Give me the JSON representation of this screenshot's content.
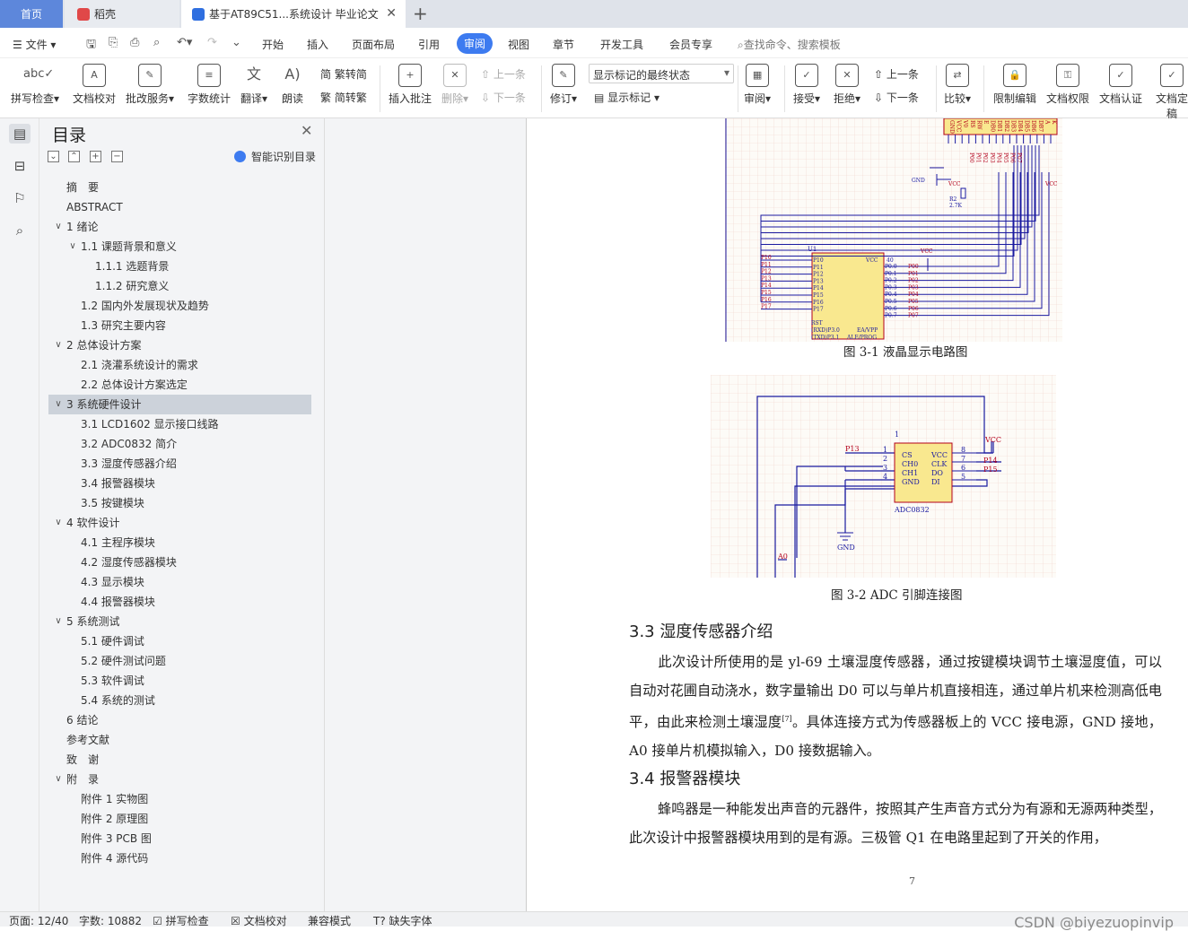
{
  "tabs": {
    "home": "首页",
    "daoke": "稻壳",
    "doc": "基于AT89C51...系统设计 毕业论文"
  },
  "menu": {
    "file": "文件",
    "items": [
      "开始",
      "插入",
      "页面布局",
      "引用",
      "审阅",
      "视图",
      "章节",
      "开发工具",
      "会员专享"
    ],
    "search": "查找命令、搜索模板"
  },
  "ribbon": {
    "spell": "拼写检查",
    "proof": "文档校对",
    "batch": "批改服务",
    "wordcount": "字数统计",
    "translate": "翻译",
    "read": "朗读",
    "trad2simp": "繁转简",
    "simp2trad": "简转繁",
    "addcomment": "插入批注",
    "delete": "删除",
    "prev": "上一条",
    "next": "下一条",
    "revise": "修订",
    "markup_state": "显示标记的最终状态",
    "show_markup": "显示标记",
    "review": "审阅",
    "accept": "接受",
    "reject": "拒绝",
    "prev2": "上一条",
    "next2": "下一条",
    "compare": "比较",
    "restrict": "限制编辑",
    "permission": "文档权限",
    "certify": "文档认证",
    "final": "文档定稿"
  },
  "toc": {
    "title": "目录",
    "smart": "智能识别目录",
    "items": [
      {
        "text": "摘　要",
        "level": 0,
        "arrow": ""
      },
      {
        "text": "ABSTRACT",
        "level": 0,
        "arrow": ""
      },
      {
        "text": "1  绪论",
        "level": 0,
        "arrow": "v"
      },
      {
        "text": "1.1  课题背景和意义",
        "level": 1,
        "arrow": "v"
      },
      {
        "text": "1.1.1 选题背景",
        "level": 2,
        "arrow": ""
      },
      {
        "text": "1.1.2 研究意义",
        "level": 2,
        "arrow": ""
      },
      {
        "text": "1.2  国内外发展现状及趋势",
        "level": 1,
        "arrow": ""
      },
      {
        "text": "1.3 研究主要内容",
        "level": 1,
        "arrow": ""
      },
      {
        "text": "2  总体设计方案",
        "level": 0,
        "arrow": "v"
      },
      {
        "text": "2.1  浇灌系统设计的需求",
        "level": 1,
        "arrow": ""
      },
      {
        "text": "2.2  总体设计方案选定",
        "level": 1,
        "arrow": ""
      },
      {
        "text": "3  系统硬件设计",
        "level": 0,
        "arrow": "v",
        "selected": true
      },
      {
        "text": "3.1 LCD1602 显示接口线路",
        "level": 1,
        "arrow": ""
      },
      {
        "text": "3.2 ADC0832 简介",
        "level": 1,
        "arrow": ""
      },
      {
        "text": "3.3  湿度传感器介绍",
        "level": 1,
        "arrow": ""
      },
      {
        "text": "3.4  报警器模块",
        "level": 1,
        "arrow": ""
      },
      {
        "text": "3.5  按键模块",
        "level": 1,
        "arrow": ""
      },
      {
        "text": "4  软件设计",
        "level": 0,
        "arrow": "v"
      },
      {
        "text": "4.1  主程序模块",
        "level": 1,
        "arrow": ""
      },
      {
        "text": "4.2  湿度传感器模块",
        "level": 1,
        "arrow": ""
      },
      {
        "text": "4.3  显示模块",
        "level": 1,
        "arrow": ""
      },
      {
        "text": "4.4  报警器模块",
        "level": 1,
        "arrow": ""
      },
      {
        "text": "5  系统测试",
        "level": 0,
        "arrow": "v"
      },
      {
        "text": "5.1  硬件调试",
        "level": 1,
        "arrow": ""
      },
      {
        "text": "5.2  硬件测试问题",
        "level": 1,
        "arrow": ""
      },
      {
        "text": "5.3  软件调试",
        "level": 1,
        "arrow": ""
      },
      {
        "text": "5.4  系统的测试",
        "level": 1,
        "arrow": ""
      },
      {
        "text": "6  结论",
        "level": 0,
        "arrow": ""
      },
      {
        "text": "参考文献",
        "level": 0,
        "arrow": ""
      },
      {
        "text": "致　谢",
        "level": 0,
        "arrow": ""
      },
      {
        "text": "附　录",
        "level": 0,
        "arrow": "v"
      },
      {
        "text": "附件 1  实物图",
        "level": 1,
        "arrow": ""
      },
      {
        "text": "附件 2  原理图",
        "level": 1,
        "arrow": ""
      },
      {
        "text": "附件 3  PCB 图",
        "level": 1,
        "arrow": ""
      },
      {
        "text": "附件 4  源代码",
        "level": 1,
        "arrow": ""
      }
    ]
  },
  "doc": {
    "cap1": "图 3-1  液晶显示电路图",
    "cap2": "图 3-2 ADC 引脚连接图",
    "h33": "3.3  湿度传感器介绍",
    "p33a": "此次设计所使用的是 yl-69 土壤湿度传感器，通过按键模块调节土壤湿度值，可以自动对花圃自动浇水，数字量输出 D0 可以与单片机直接相连，通过单片机来检测高低电平，由此来检测土壤湿度",
    "ref": "[7]",
    "p33b": "。具体连接方式为传感器板上的 VCC 接电源，GND 接地，A0 接单片机模拟输入，D0 接数据输入。",
    "h34": "3.4  报警器模块",
    "p34": "蜂鸣器是一种能发出声音的元器件，按照其产生声音方式分为有源和无源两种类型，此次设计中报警器模块用到的是有源。三极管 Q1 在电路里起到了开关的作用，",
    "pagenum": "7"
  },
  "schematic1": {
    "chip": "U1",
    "vcc": "VCC",
    "gnd": "GND",
    "r2": "R2",
    "r2val": "2.7K",
    "port1": [
      "P10",
      "P11",
      "P12",
      "P13",
      "P14",
      "P15",
      "P16",
      "P17"
    ],
    "port0": [
      "P0.0",
      "P0.1",
      "P0.2",
      "P0.3",
      "P0.4",
      "P0.5",
      "P0.6",
      "P0.7"
    ],
    "p0nets": [
      "P00",
      "P01",
      "P02",
      "P03",
      "P04",
      "P05",
      "P06",
      "P07"
    ],
    "lcdpins": [
      "GND",
      "VCC",
      "V0",
      "RS",
      "RW",
      "E",
      "DB0",
      "DB1",
      "DB2",
      "DB3",
      "DB4",
      "DB5",
      "DB6",
      "DB7",
      "A",
      "K"
    ],
    "rst": "RST",
    "rxd": "(RXD)P3.0",
    "txd": "(TXD)P3.1",
    "ea": "EA/VPP",
    "ale": "ALE/PROG",
    "pin40": "40"
  },
  "schematic2": {
    "chip": "ADC0832",
    "pin1label": "1",
    "left_pins": [
      "CS",
      "CH0",
      "CH1",
      "GND"
    ],
    "right_pins": [
      "VCC",
      "CLK",
      "DO",
      "DI"
    ],
    "left_nums": [
      "1",
      "2",
      "3",
      "4"
    ],
    "right_nums": [
      "8",
      "7",
      "6",
      "5"
    ],
    "nets": {
      "p13": "P13",
      "p14": "P14",
      "p15": "P15",
      "vcc": "VCC",
      "gnd": "GND",
      "a0": "A0"
    }
  },
  "status": {
    "page": "页面: 12/40",
    "words": "字数: 10882",
    "spell": "拼写检查",
    "proof": "文档校对",
    "compat": "兼容模式",
    "font": "缺失字体"
  },
  "watermark": "CSDN @biyezuopinvip",
  "colors": {
    "accent": "#3d7bf0",
    "home_tab": "#5d87db",
    "schematic_wire": "#1a1aa0",
    "schematic_label": "#b3001b",
    "chip_fill": "#f9e88f"
  }
}
